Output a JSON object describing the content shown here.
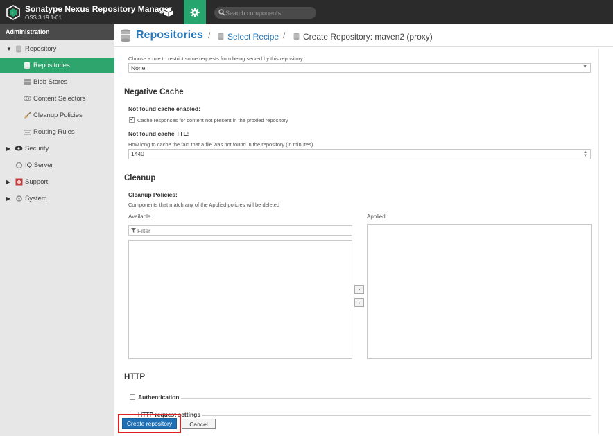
{
  "header": {
    "title": "Sonatype Nexus Repository Manager",
    "version": "OSS 3.19.1-01",
    "search_placeholder": "Search components"
  },
  "sidebar": {
    "header": "Administration",
    "items": [
      {
        "label": "Repository"
      },
      {
        "label": "Repositories"
      },
      {
        "label": "Blob Stores"
      },
      {
        "label": "Content Selectors"
      },
      {
        "label": "Cleanup Policies"
      },
      {
        "label": "Routing Rules"
      },
      {
        "label": "Security"
      },
      {
        "label": "IQ Server"
      },
      {
        "label": "Support"
      },
      {
        "label": "System"
      }
    ]
  },
  "breadcrumb": {
    "repositories": "Repositories",
    "sep": "/",
    "select_recipe": "Select Recipe",
    "create": "Create Repository: maven2 (proxy)"
  },
  "routing": {
    "help": "Choose a rule to restrict some requests from being served by this repository",
    "value": "None"
  },
  "negative_cache": {
    "title": "Negative Cache",
    "enabled_label": "Not found cache enabled:",
    "enabled_checkbox_label": "Cache responses for content not present in the proxied repository",
    "enabled": true,
    "ttl_label": "Not found cache TTL:",
    "ttl_help": "How long to cache the fact that a file was not found in the repository (in minutes)",
    "ttl_value": "1440"
  },
  "cleanup": {
    "title": "Cleanup",
    "policies_label": "Cleanup Policies:",
    "help": "Components that match any of the Applied policies will be deleted",
    "available_label": "Available",
    "applied_label": "Applied",
    "filter_placeholder": "Filter",
    "add_symbol": "›",
    "remove_symbol": "‹"
  },
  "http": {
    "title": "HTTP",
    "authentication": "Authentication",
    "request_settings": "HTTP request settings"
  },
  "actions": {
    "create": "Create repository",
    "cancel": "Cancel"
  }
}
